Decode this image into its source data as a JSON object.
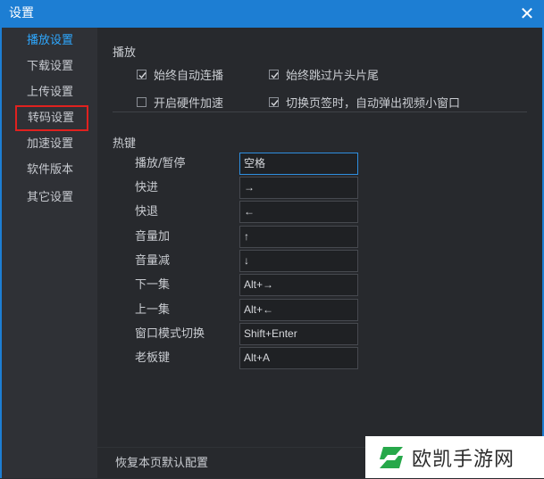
{
  "window": {
    "title": "设置",
    "close_glyph": "✕"
  },
  "sidebar": {
    "items": [
      {
        "label": "播放设置",
        "state": "active"
      },
      {
        "label": "下载设置"
      },
      {
        "label": "上传设置"
      },
      {
        "label": "转码设置",
        "state": "highlighted"
      },
      {
        "label": "加速设置"
      },
      {
        "label": "软件版本"
      },
      {
        "label": "其它设置"
      }
    ]
  },
  "playback": {
    "title": "播放",
    "options": [
      {
        "label": "始终自动连播",
        "checked": true
      },
      {
        "label": "始终跳过片头片尾",
        "checked": true
      },
      {
        "label": "开启硬件加速",
        "checked": false
      },
      {
        "label": "切换页签时，自动弹出视频小窗口",
        "checked": true
      }
    ]
  },
  "hotkeys": {
    "title": "热键",
    "rows": [
      {
        "label": "播放/暂停",
        "value": "空格"
      },
      {
        "label": "快进",
        "value": "→"
      },
      {
        "label": "快退",
        "value": "←"
      },
      {
        "label": "音量加",
        "value": "↑"
      },
      {
        "label": "音量减",
        "value": "↓"
      },
      {
        "label": "下一集",
        "value": "Alt+→"
      },
      {
        "label": "上一集",
        "value": "Alt+←"
      },
      {
        "label": "窗口模式切换",
        "value": "Shift+Enter"
      },
      {
        "label": "老板键",
        "value": "Alt+A"
      }
    ]
  },
  "footer": {
    "reset_label": "恢复本页默认配置"
  },
  "watermark": {
    "text": "欧凯手游网"
  },
  "colors": {
    "accent": "#1d7ed3",
    "active_text": "#2ea8ff",
    "highlight_border": "#e0211f",
    "watermark_logo": "#27a84a"
  }
}
